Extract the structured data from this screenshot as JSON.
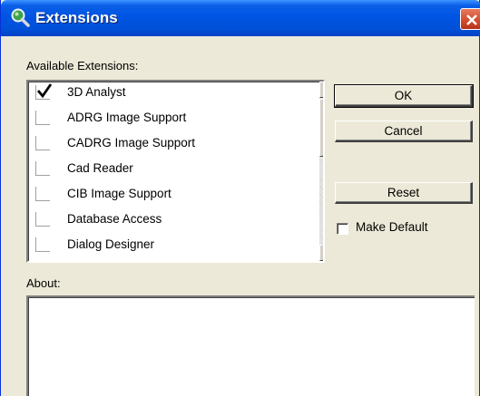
{
  "window": {
    "title": "Extensions"
  },
  "labels": {
    "available": "Available Extensions:",
    "about": "About:"
  },
  "extensions": [
    {
      "label": "3D Analyst",
      "checked": true
    },
    {
      "label": "ADRG Image Support",
      "checked": false
    },
    {
      "label": "CADRG Image Support",
      "checked": false
    },
    {
      "label": "Cad Reader",
      "checked": false
    },
    {
      "label": "CIB Image Support",
      "checked": false
    },
    {
      "label": "Database Access",
      "checked": false
    },
    {
      "label": "Dialog Designer",
      "checked": false
    }
  ],
  "buttons": {
    "ok": "OK",
    "cancel": "Cancel",
    "reset": "Reset"
  },
  "make_default": {
    "label": "Make Default",
    "checked": false
  },
  "about_text": "",
  "colors": {
    "titlebar": "#0054e3",
    "close": "#d14b2c",
    "dialog_bg": "#ece9d8"
  }
}
